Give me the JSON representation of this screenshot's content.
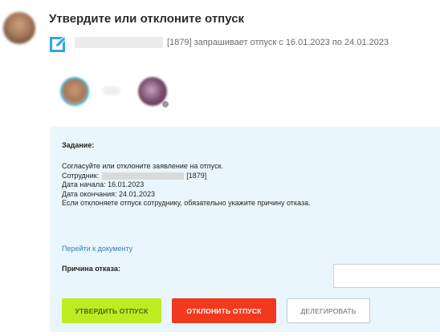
{
  "header": {
    "title": "Утвердите или отклоните отпуск",
    "request_text": "[1879] запрашивает отпуск с 16.01.2023 по 24.01.2023"
  },
  "task": {
    "heading": "Задание:",
    "instruction": "Согласуйте или отклоните заявление на отпуск.",
    "employee_label": "Сотрудник:",
    "employee_id": "[1879]",
    "start_date": "Дата начала: 16.01.2023",
    "end_date": "Дата окончания: 24.01.2023",
    "note": "Если отклоняете отпуск сотруднику, обязательно укажите причину отказа.",
    "document_link": "Перейти к документу",
    "reason_label": "Причина отказа:",
    "reason_value": ""
  },
  "buttons": {
    "approve": "УТВЕРДИТЬ ОТПУСК",
    "reject": "ОТКЛОНИТЬ ОТПУСК",
    "delegate": "ДЕЛЕГИРОВАТЬ"
  },
  "colors": {
    "panel_bg": "#e9f6fd",
    "approve_bg": "#bbed21",
    "reject_bg": "#f1391f",
    "link": "#2f7fc1",
    "icon": "#2fa6e0"
  },
  "icons": {
    "request": "edit-document-icon"
  }
}
